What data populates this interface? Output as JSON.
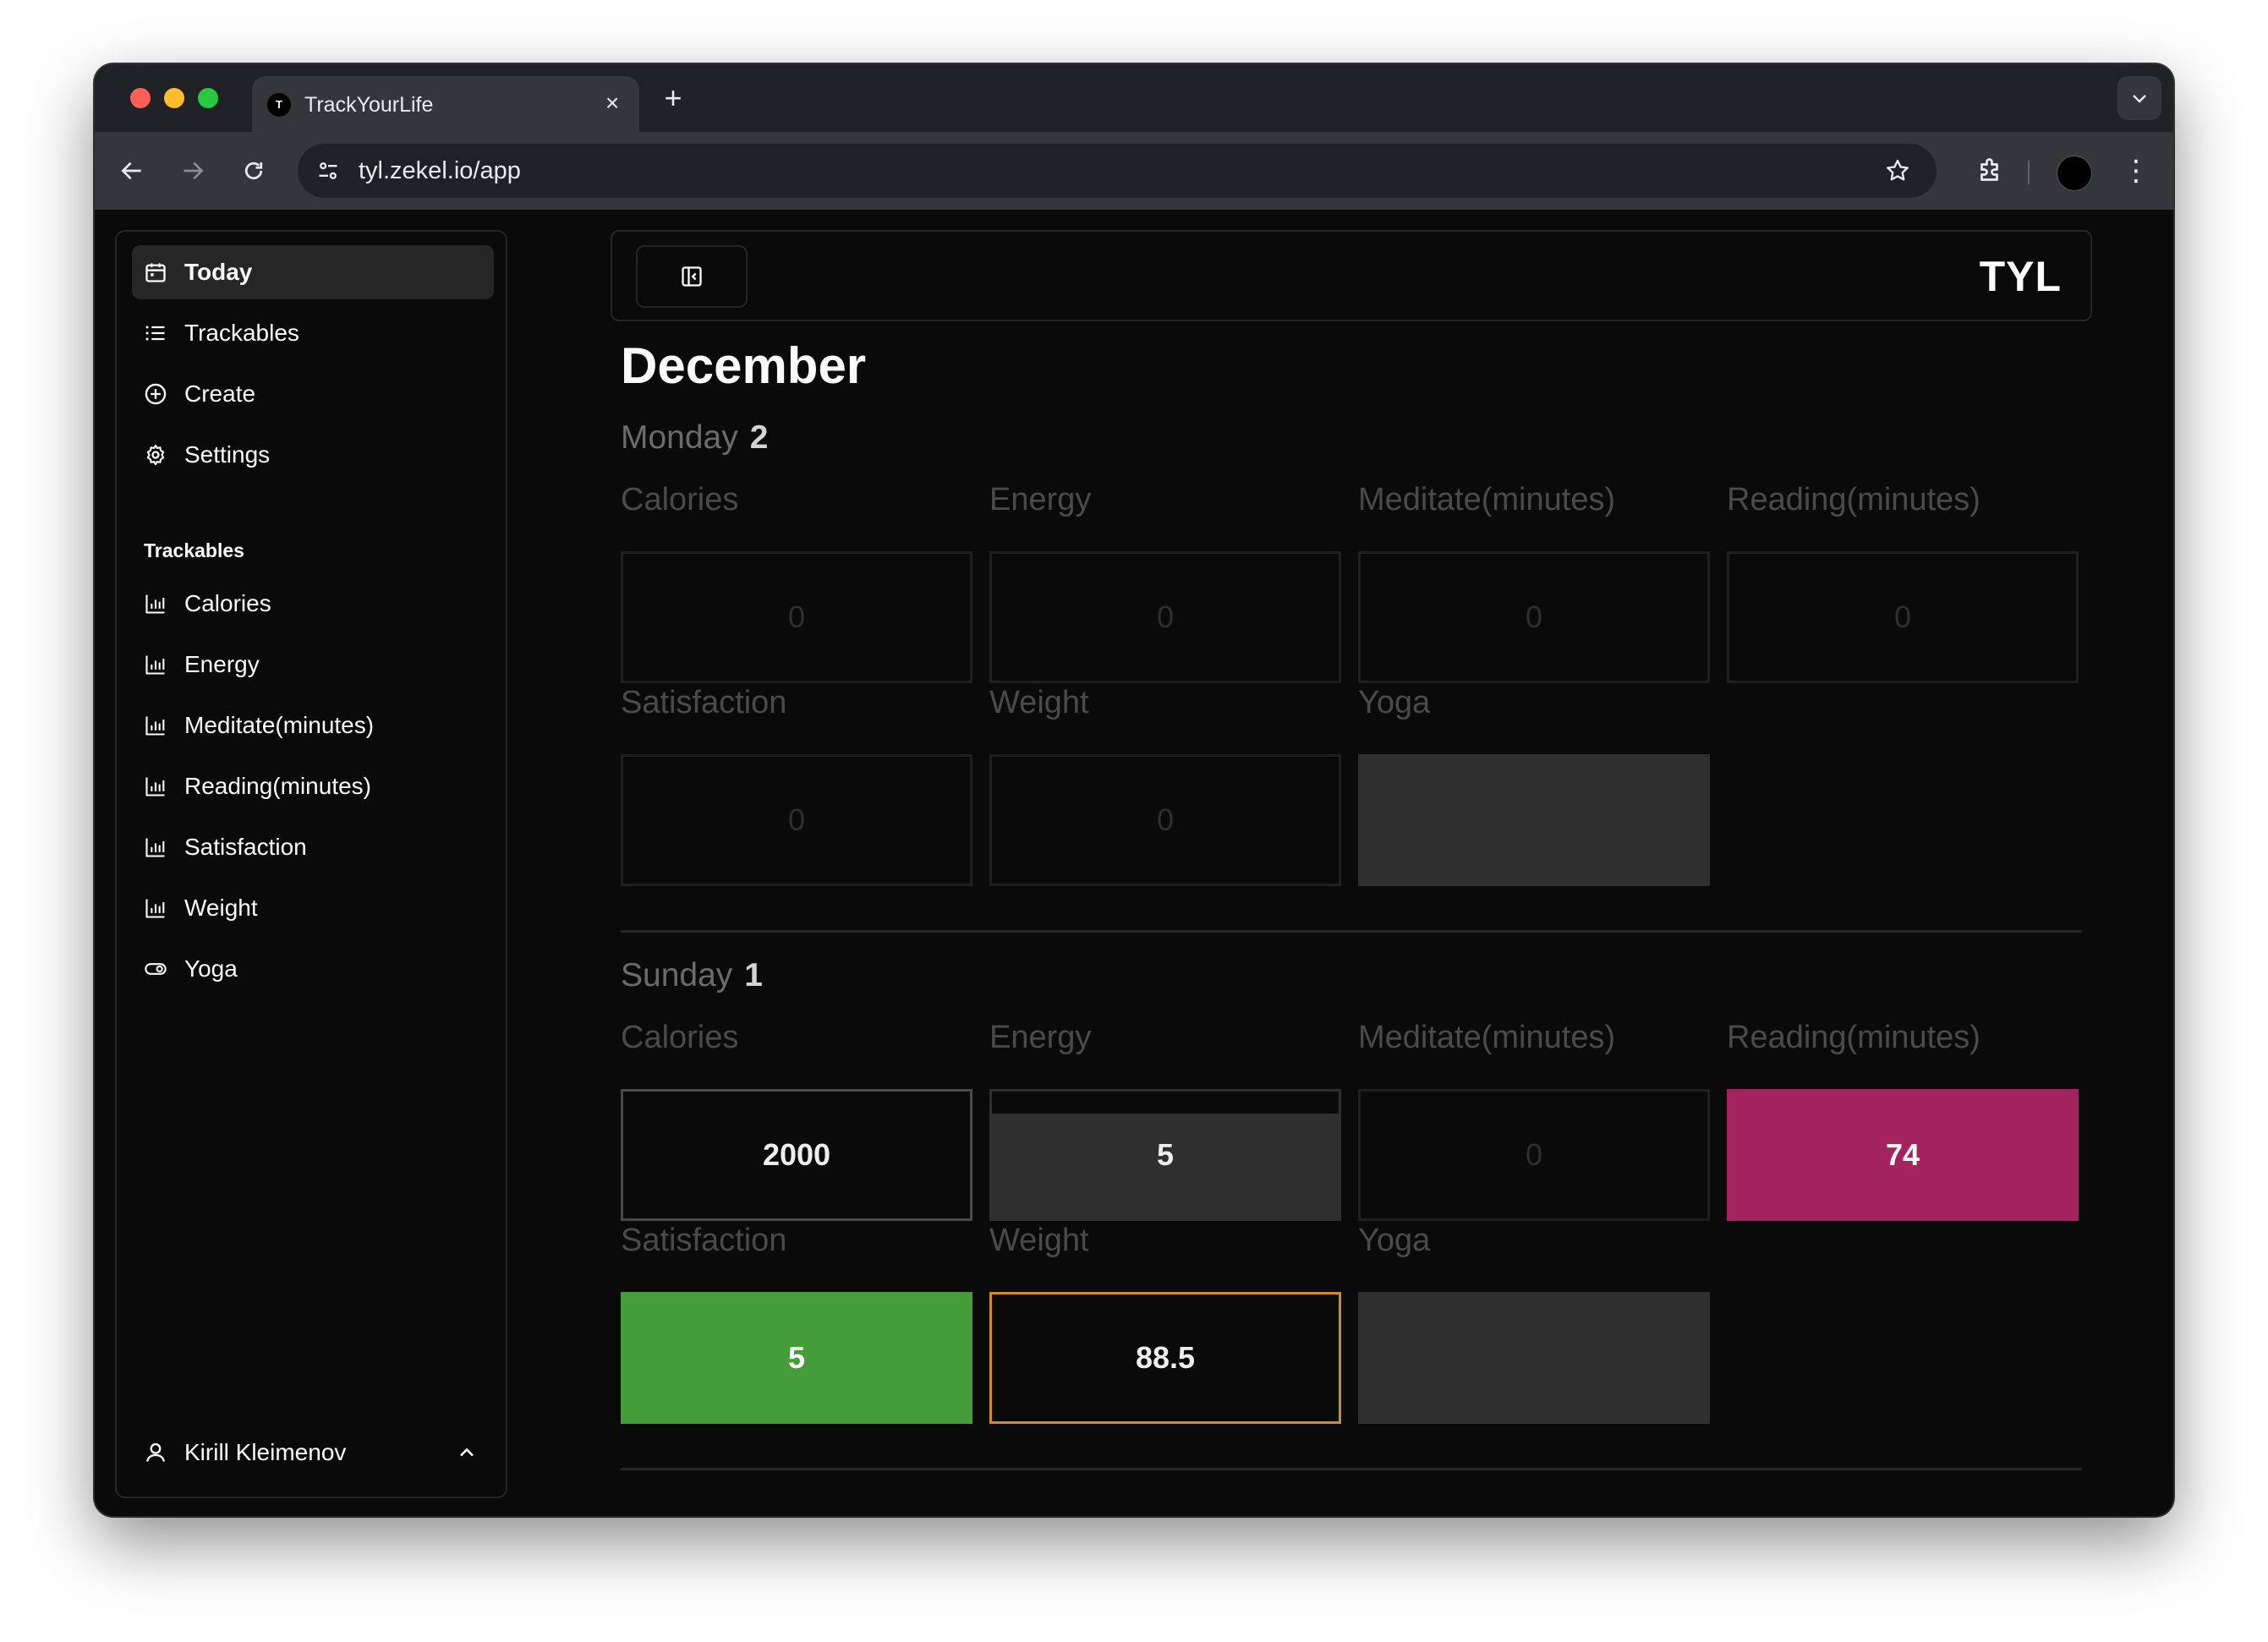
{
  "browser": {
    "tab_title": "TrackYourLife",
    "tab_favicon_letter": "T",
    "url": "tyl.zekel.io/app"
  },
  "sidebar": {
    "nav": [
      {
        "label": "Today",
        "icon": "calendar-icon",
        "active": true
      },
      {
        "label": "Trackables",
        "icon": "list-icon",
        "active": false
      },
      {
        "label": "Create",
        "icon": "plus-circle-icon",
        "active": false
      },
      {
        "label": "Settings",
        "icon": "gear-icon",
        "active": false
      }
    ],
    "section_label": "Trackables",
    "trackables": [
      {
        "label": "Calories",
        "icon": "bar-chart-icon"
      },
      {
        "label": "Energy",
        "icon": "bar-chart-icon"
      },
      {
        "label": "Meditate(minutes)",
        "icon": "bar-chart-icon"
      },
      {
        "label": "Reading(minutes)",
        "icon": "bar-chart-icon"
      },
      {
        "label": "Satisfaction",
        "icon": "bar-chart-icon"
      },
      {
        "label": "Weight",
        "icon": "bar-chart-icon"
      },
      {
        "label": "Yoga",
        "icon": "toggle-icon"
      }
    ],
    "user_name": "Kirill Kleimenov"
  },
  "header": {
    "logo": "TYL"
  },
  "main": {
    "month": "December",
    "days": [
      {
        "weekday": "Monday",
        "day_num": "2",
        "cells": [
          {
            "label": "Calories",
            "value": "0"
          },
          {
            "label": "Energy",
            "value": "0"
          },
          {
            "label": "Meditate(minutes)",
            "value": "0"
          },
          {
            "label": "Reading(minutes)",
            "value": "0"
          },
          {
            "label": "Satisfaction",
            "value": "0"
          },
          {
            "label": "Weight",
            "value": "0"
          },
          {
            "label": "Yoga",
            "value": ""
          }
        ]
      },
      {
        "weekday": "Sunday",
        "day_num": "1",
        "cells": [
          {
            "label": "Calories",
            "value": "2000"
          },
          {
            "label": "Energy",
            "value": "5"
          },
          {
            "label": "Meditate(minutes)",
            "value": "0"
          },
          {
            "label": "Reading(minutes)",
            "value": "74"
          },
          {
            "label": "Satisfaction",
            "value": "5"
          },
          {
            "label": "Weight",
            "value": "88.5"
          },
          {
            "label": "Yoga",
            "value": ""
          }
        ]
      }
    ]
  },
  "colors": {
    "reading_fill": "#a3235e",
    "satisfaction_fill": "#459d39",
    "weight_border": "#d08a2a",
    "background": "#0a0a0a"
  }
}
